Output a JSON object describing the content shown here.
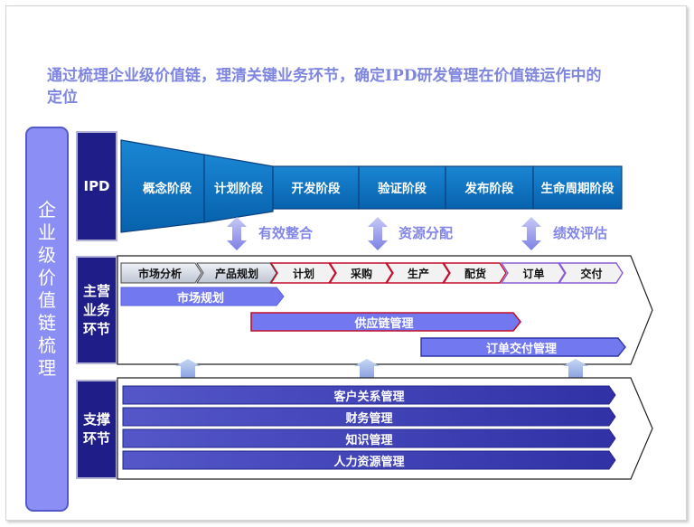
{
  "headline": "通过梳理企业级价值链，理清关键业务环节，确定IPD研发管理在价值链运作中的定位",
  "vertical_label": "企业级价值链梳理",
  "rows": {
    "ipd": "IPD",
    "main": "主营业务环节",
    "support": "支撑环节"
  },
  "ipd_stages": [
    "概念阶段",
    "计划阶段",
    "开发阶段",
    "验证阶段",
    "发布阶段",
    "生命周期阶段"
  ],
  "integrations": [
    "有效整合",
    "资源分配",
    "绩效评估"
  ],
  "main_steps": [
    "市场分析",
    "产品规划",
    "计划",
    "采购",
    "生产",
    "配货",
    "订单",
    "交付"
  ],
  "main_bars": [
    "市场规划",
    "供应链管理",
    "订单交付管理"
  ],
  "support_bars": [
    "客户关系管理",
    "财务管理",
    "知识管理",
    "人力资源管理"
  ],
  "colors": {
    "navy": "#1f1d88",
    "ipd_blue": "#0a74c4",
    "accent_text": "#7f86e0",
    "market_gray": "#c9d0dc",
    "supply_red": "#c40f2f",
    "order_purple": "#8a5cd6",
    "bar_purple": "#7278f0",
    "support_bar": "#383bb0"
  }
}
